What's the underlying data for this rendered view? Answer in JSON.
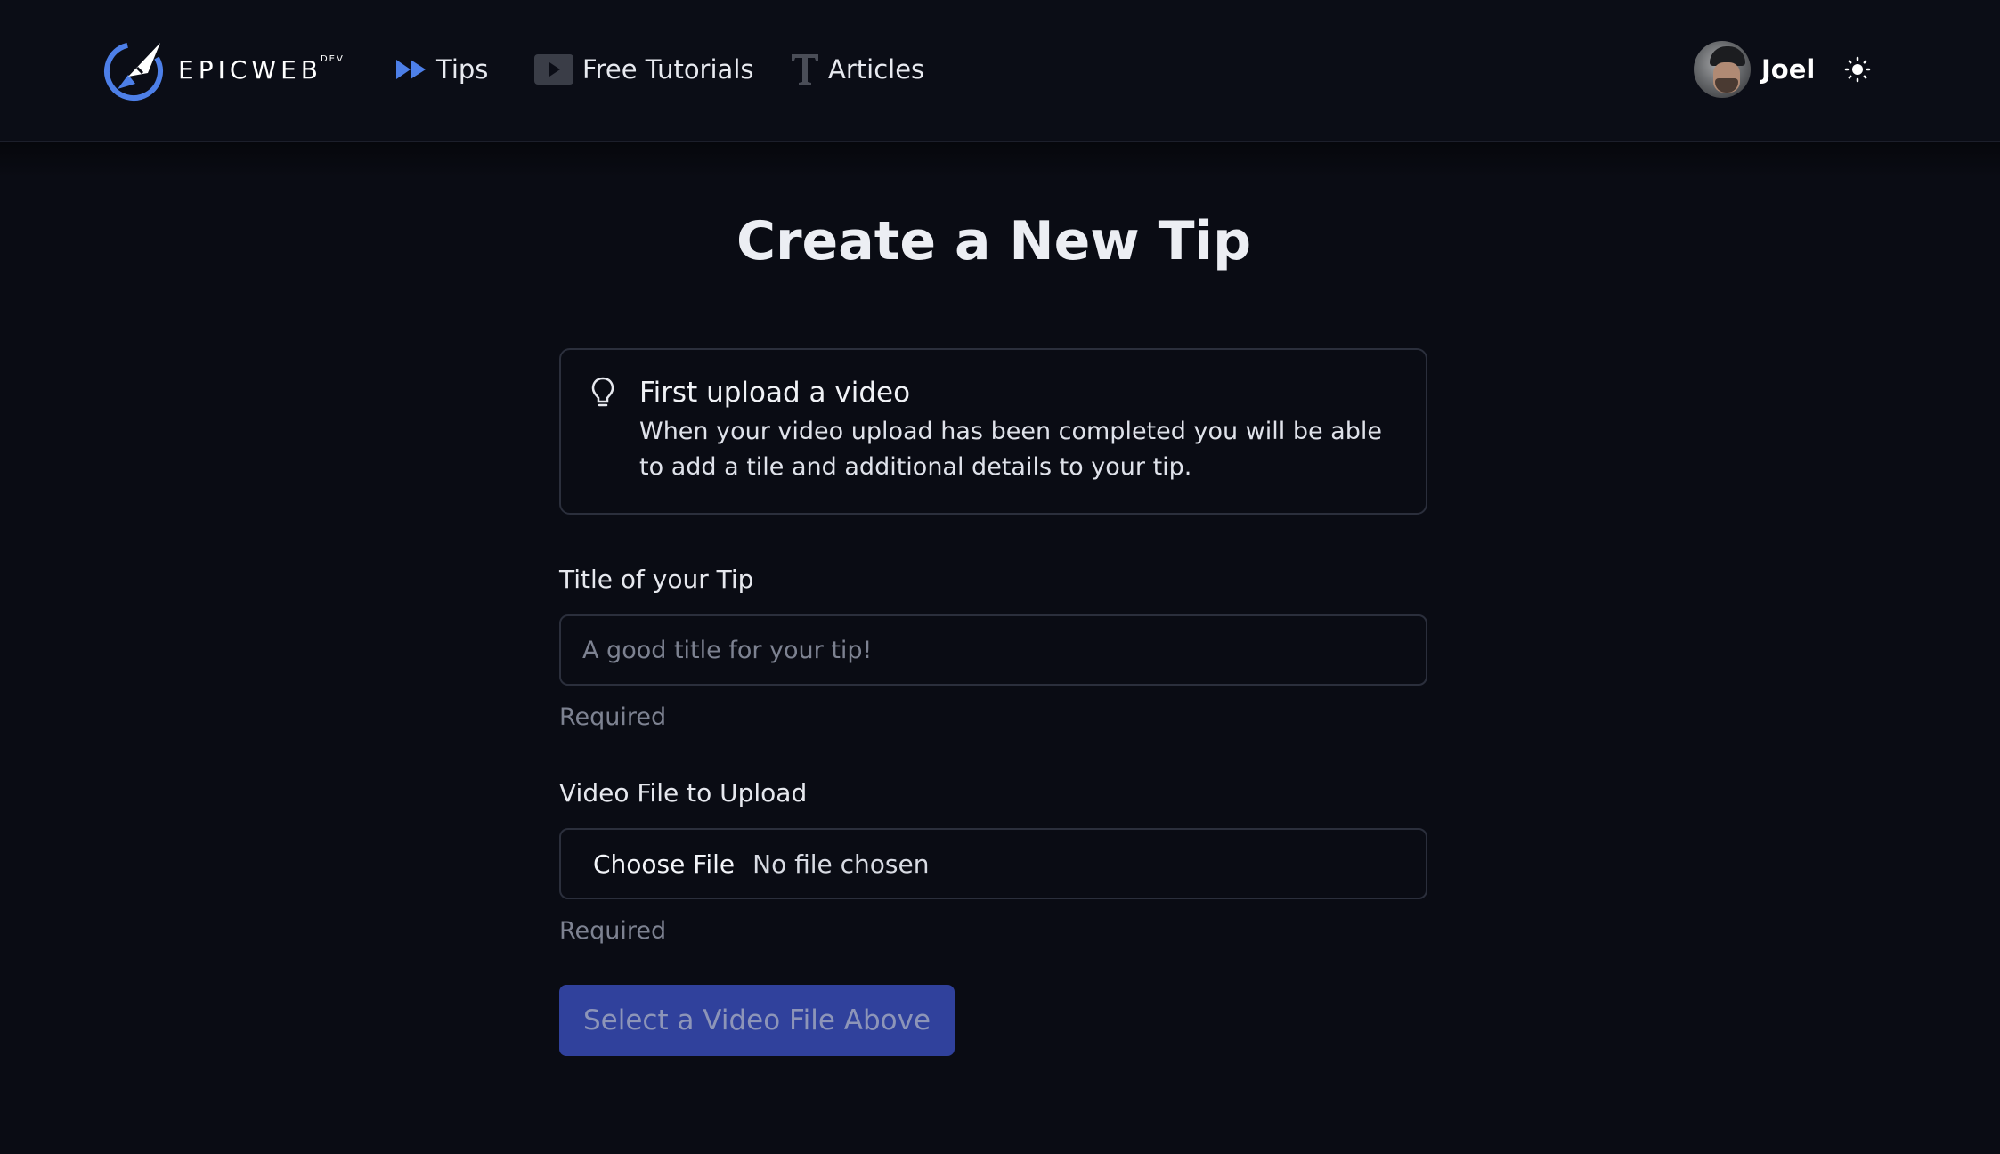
{
  "header": {
    "logo_text": "EPICWEB",
    "logo_sup": "DEV",
    "nav": [
      {
        "label": "Tips",
        "icon": "fast-forward-icon"
      },
      {
        "label": "Free Tutorials",
        "icon": "play-icon"
      },
      {
        "label": "Articles",
        "icon": "text-t-icon"
      }
    ],
    "user_name": "Joel",
    "theme_icon": "sun-icon"
  },
  "main": {
    "title": "Create a New Tip",
    "callout": {
      "icon": "lightbulb-icon",
      "title": "First upload a video",
      "body": "When your video upload has been completed you will be able to add a tile and additional details to your tip."
    },
    "form": {
      "title_label": "Title of your Tip",
      "title_placeholder": "A good title for your tip!",
      "title_value": "",
      "title_hint": "Required",
      "video_label": "Video File to Upload",
      "file_button": "Choose File",
      "file_status": "No file chosen",
      "video_hint": "Required",
      "submit_label": "Select a Video File Above"
    }
  },
  "colors": {
    "background": "#0a0c14",
    "accent": "#4d7fe8",
    "submit_disabled": "#30419c"
  }
}
